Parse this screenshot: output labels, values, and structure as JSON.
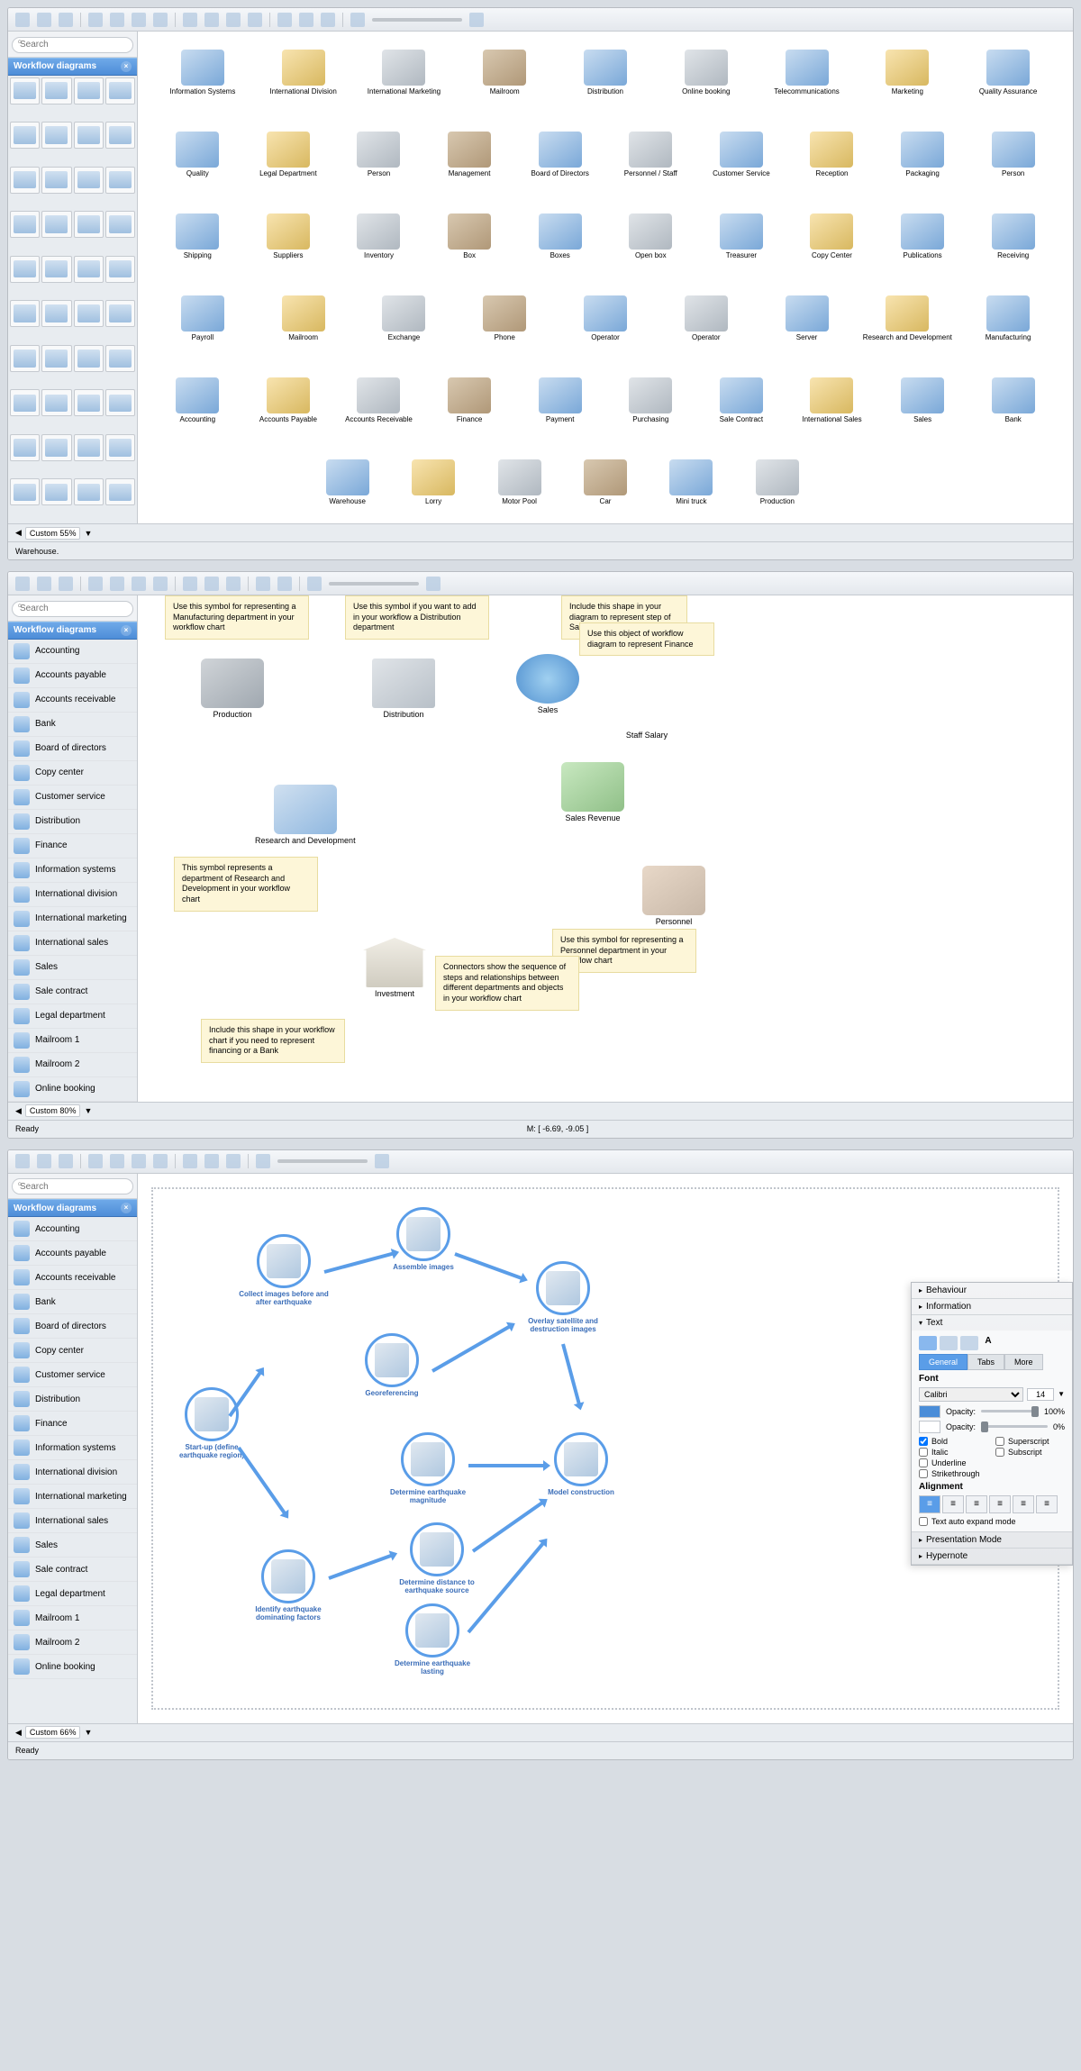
{
  "shared": {
    "search_ph": "Search",
    "panel_title": "Workflow diagrams"
  },
  "app1": {
    "zoom": "Custom 55%",
    "status": "Warehouse.",
    "icons_r1": [
      "Information Systems",
      "International Division",
      "International Marketing",
      "Mailroom",
      "Distribution",
      "Online booking",
      "Telecommunications",
      "Marketing",
      "Quality Assurance"
    ],
    "icons_r2": [
      "Quality",
      "Legal Department",
      "Person",
      "Management",
      "Board of Directors",
      "Personnel / Staff",
      "Customer Service",
      "Reception",
      "Packaging",
      "Person"
    ],
    "icons_r3": [
      "Shipping",
      "Suppliers",
      "Inventory",
      "Box",
      "Boxes",
      "Open box",
      "Treasurer",
      "Copy Center",
      "Publications",
      "Receiving"
    ],
    "icons_r4": [
      "Payroll",
      "Mailroom",
      "Exchange",
      "Phone",
      "Operator",
      "Operator",
      "Server",
      "Research and Development",
      "Manufacturing"
    ],
    "icons_r5": [
      "Accounting",
      "Accounts Payable",
      "Accounts Receivable",
      "Finance",
      "Payment",
      "Purchasing",
      "Sale Contract",
      "International Sales",
      "Sales",
      "Bank"
    ],
    "icons_r6": [
      "Warehouse",
      "Lorry",
      "Motor Pool",
      "Car",
      "Mini truck",
      "Production"
    ]
  },
  "app2": {
    "zoom": "Custom 80%",
    "status_left": "Ready",
    "status_mid": "M: [ -6.69, -9.05 ]",
    "side": [
      "Accounting",
      "Accounts payable",
      "Accounts receivable",
      "Bank",
      "Board of directors",
      "Copy center",
      "Customer service",
      "Distribution",
      "Finance",
      "Information systems",
      "International division",
      "International marketing",
      "International sales",
      "Sales",
      "Sale contract",
      "Legal department",
      "Mailroom 1",
      "Mailroom 2",
      "Online booking"
    ],
    "nodes": {
      "prod": "Production",
      "dist": "Distribution",
      "sales": "Sales",
      "rnd": "Research and Development",
      "inv": "Investment",
      "pers": "Personnel",
      "salrev": "Sales Revenue",
      "salary": "Staff Salary"
    },
    "notes": {
      "prod": "Use this symbol for representing a Manufacturing department in your workflow chart",
      "dist": "Use this symbol if you want to add in your workflow a Distribution department",
      "sales": "Include this shape in your diagram to represent step of Sales in work process",
      "fin": "Use this object of workflow diagram to represent Finance",
      "rnd": "This symbol represents a department of Research and Development in your workflow chart",
      "pers": "Use this symbol for representing a Personnel department in your workflow chart",
      "con": "Connectors show the sequence of steps and relationships between different departments and objects in your workflow chart",
      "bank": "Include this shape in your workflow chart if you need to represent financing or a Bank"
    }
  },
  "app3": {
    "zoom": "Custom 66%",
    "status": "Ready",
    "side": [
      "Accounting",
      "Accounts payable",
      "Accounts receivable",
      "Bank",
      "Board of directors",
      "Copy center",
      "Customer service",
      "Distribution",
      "Finance",
      "Information systems",
      "International division",
      "International marketing",
      "International sales",
      "Sales",
      "Sale contract",
      "Legal department",
      "Mailroom 1",
      "Mailroom 2",
      "Online booking"
    ],
    "nodes": {
      "start": "Start-up (define earthquake region)",
      "collect": "Collect images before and after earthquake",
      "assemble": "Assemble images",
      "overlay": "Overlay satellite and destruction images",
      "geo": "Georeferencing",
      "mag": "Determine earthquake magnitude",
      "model": "Model construction",
      "ident": "Identify earthquake dominating factors",
      "distn": "Determine distance to earthquake source",
      "last": "Determine earthquake lasting"
    },
    "props": {
      "sections": [
        "Behaviour",
        "Information",
        "Text"
      ],
      "tabs": [
        "General",
        "Tabs",
        "More"
      ],
      "font_label": "Font",
      "font": "Calibri",
      "size": "14",
      "opacity_label": "Opacity:",
      "op1": "100%",
      "op2": "0%",
      "styles": {
        "bold": "Bold",
        "italic": "Italic",
        "underline": "Underline",
        "strike": "Strikethrough",
        "super": "Superscript",
        "sub": "Subscript"
      },
      "align_label": "Alignment",
      "auto": "Text auto expand mode",
      "more": [
        "Presentation Mode",
        "Hypernote"
      ]
    }
  }
}
